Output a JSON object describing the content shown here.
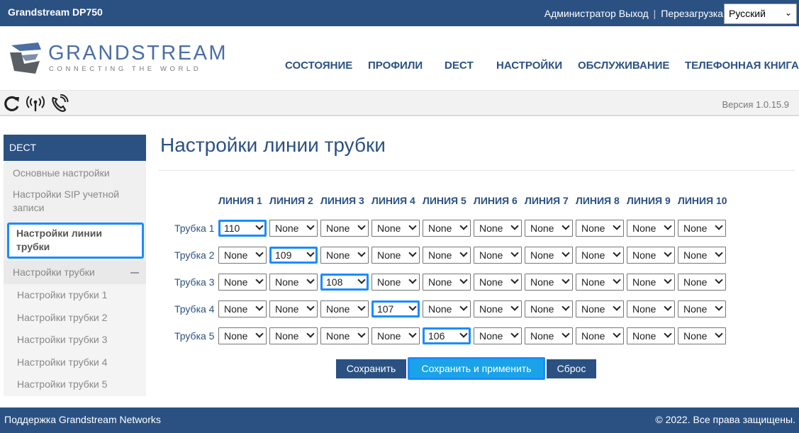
{
  "topbar": {
    "brand": "Grandstream DP750",
    "admin_label": "Администратор",
    "logout_label": "Выход",
    "reboot_label": "Перезагрузка",
    "language_value": "Русский"
  },
  "logo": {
    "name": "GRANDSTREAM",
    "tagline": "CONNECTING THE WORLD"
  },
  "mainnav": [
    "СОСТОЯНИЕ",
    "ПРОФИЛИ",
    "DECT",
    "НАСТРОЙКИ",
    "ОБСЛУЖИВАНИЕ",
    "ТЕЛЕФОННАЯ КНИГА"
  ],
  "toolbar": {
    "version": "Версия 1.0.15.9",
    "icons": [
      "refresh-icon",
      "antenna-icon",
      "phone-call-icon"
    ]
  },
  "sidebar": {
    "header": "DECT",
    "items": [
      "Основные настройки",
      "Настройки SIP учетной записи",
      "Настройки линии трубки",
      "Настройки трубки"
    ],
    "subitems": [
      "Настройки трубки 1",
      "Настройки трубки 2",
      "Настройки трубки 3",
      "Настройки трубки 4",
      "Настройки трубки 5"
    ]
  },
  "page": {
    "title": "Настройки линии трубки"
  },
  "table": {
    "columns": [
      "ЛИНИЯ 1",
      "ЛИНИЯ 2",
      "ЛИНИЯ 3",
      "ЛИНИЯ 4",
      "ЛИНИЯ 5",
      "ЛИНИЯ 6",
      "ЛИНИЯ 7",
      "ЛИНИЯ 8",
      "ЛИНИЯ 9",
      "ЛИНИЯ 10"
    ],
    "rows": [
      {
        "label": "Трубка 1",
        "values": [
          "110",
          "None",
          "None",
          "None",
          "None",
          "None",
          "None",
          "None",
          "None",
          "None"
        ]
      },
      {
        "label": "Трубка 2",
        "values": [
          "None",
          "109",
          "None",
          "None",
          "None",
          "None",
          "None",
          "None",
          "None",
          "None"
        ]
      },
      {
        "label": "Трубка 3",
        "values": [
          "None",
          "None",
          "108",
          "None",
          "None",
          "None",
          "None",
          "None",
          "None",
          "None"
        ]
      },
      {
        "label": "Трубка 4",
        "values": [
          "None",
          "None",
          "None",
          "107",
          "None",
          "None",
          "None",
          "None",
          "None",
          "None"
        ]
      },
      {
        "label": "Трубка 5",
        "values": [
          "None",
          "None",
          "None",
          "None",
          "106",
          "None",
          "None",
          "None",
          "None",
          "None"
        ]
      }
    ]
  },
  "buttons": {
    "save": "Сохранить",
    "apply": "Сохранить и применить",
    "reset": "Сброс"
  },
  "footer": {
    "left": "Поддержка Grandstream Networks",
    "right": "© 2022. Все права защищены."
  },
  "colors": {
    "brand": "#2b5182",
    "highlight": "#1a8cff",
    "apply": "#1aa3e8"
  }
}
